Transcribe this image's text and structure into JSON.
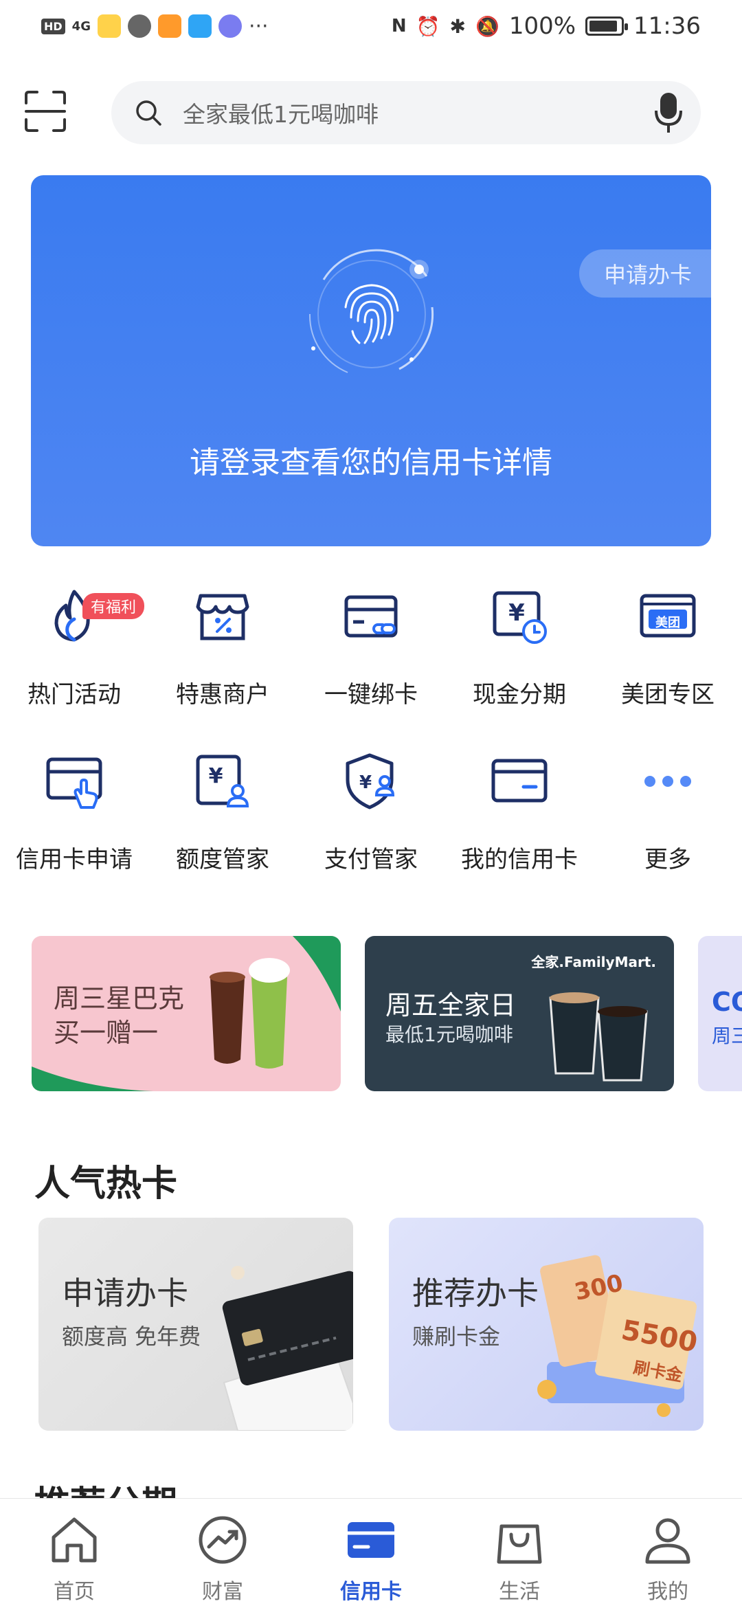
{
  "status_bar": {
    "network_tag": "HD",
    "signal": "4G",
    "battery": "100%",
    "time": "11:36",
    "more": "···"
  },
  "search": {
    "placeholder": "全家最低1元喝咖啡"
  },
  "hero": {
    "apply_label": "申请办卡",
    "login_prompt": "请登录查看您的信用卡详情"
  },
  "quick_actions": [
    {
      "label": "热门活动",
      "icon": "fire-icon",
      "badge": "有福利"
    },
    {
      "label": "特惠商户",
      "icon": "shop-discount-icon"
    },
    {
      "label": "一键绑卡",
      "icon": "bind-card-icon"
    },
    {
      "label": "现金分期",
      "icon": "cash-installment-icon"
    },
    {
      "label": "美团专区",
      "icon": "meituan-icon",
      "icon_text": "美团"
    },
    {
      "label": "信用卡申请",
      "icon": "card-apply-icon"
    },
    {
      "label": "额度管家",
      "icon": "limit-manager-icon"
    },
    {
      "label": "支付管家",
      "icon": "payment-manager-icon"
    },
    {
      "label": "我的信用卡",
      "icon": "my-card-icon"
    },
    {
      "label": "更多",
      "icon": "more-dots-icon"
    }
  ],
  "promos": [
    {
      "title_line1": "周三星巴克",
      "title_line2": "买一赠一",
      "bg": "#f7c6cf"
    },
    {
      "title": "周五全家日",
      "subtitle": "最低1元喝咖啡",
      "brand": "全家.FamilyMart.",
      "bg": "#2e3f4c"
    },
    {
      "title": "CO",
      "subtitle": "周三",
      "bg": "#e3e2f8"
    }
  ],
  "hot_cards_section": {
    "title": "人气热卡"
  },
  "hot_cards": [
    {
      "title": "申请办卡",
      "subtitle": "额度高 免年费"
    },
    {
      "title": "推荐办卡",
      "subtitle": "赚刷卡金",
      "ticket_300": "300",
      "ticket_5500": "5500",
      "ticket_caption": "刷卡金"
    }
  ],
  "next_section": {
    "title": "推荐分期"
  },
  "bottom_nav": [
    {
      "label": "首页",
      "icon": "home-icon"
    },
    {
      "label": "财富",
      "icon": "wealth-icon"
    },
    {
      "label": "信用卡",
      "icon": "credit-card-icon",
      "active": true
    },
    {
      "label": "生活",
      "icon": "shopping-bag-icon"
    },
    {
      "label": "我的",
      "icon": "profile-icon"
    }
  ],
  "colors": {
    "primary_blue": "#2a5bd7",
    "hero_blue": "#3a7bf0",
    "icon_navy": "#1e2f66",
    "badge_red": "#f0505a"
  }
}
